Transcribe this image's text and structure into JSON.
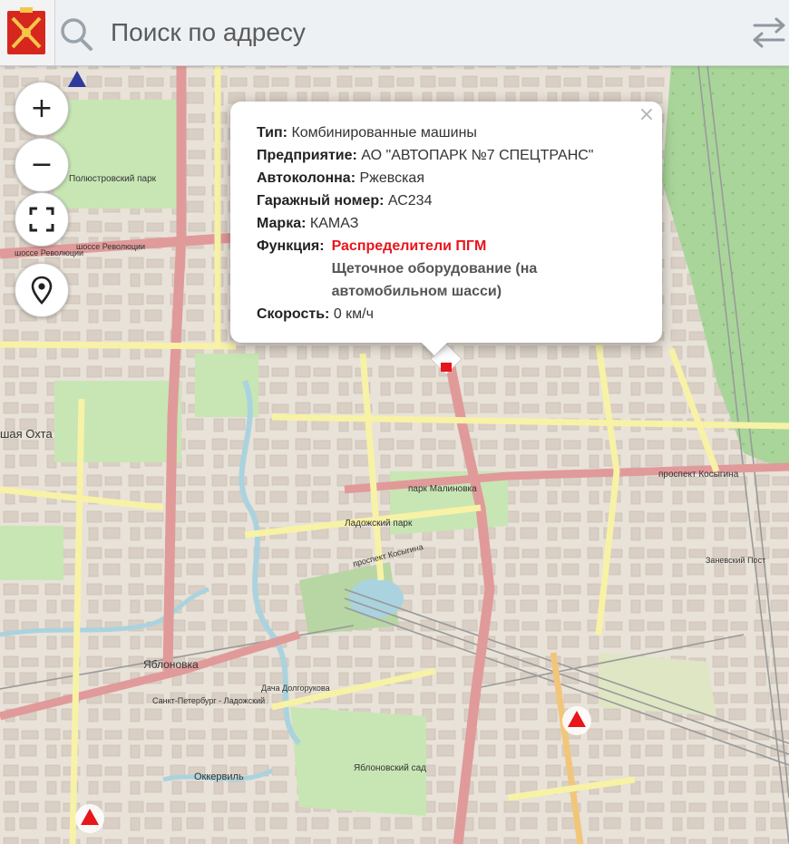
{
  "search": {
    "placeholder": "Поиск по адресу"
  },
  "icons": {
    "logo": "spb-coat-of-arms",
    "search": "search-icon",
    "swap": "swap-arrows-icon",
    "zoom_in": "plus-icon",
    "zoom_out": "minus-icon",
    "fullscreen": "fullscreen-icon",
    "locate": "location-pin-icon",
    "close": "close-icon"
  },
  "controls": {
    "zoom_in": "+",
    "zoom_out": "−"
  },
  "popup": {
    "close": "×",
    "rows": [
      {
        "label": "Тип:",
        "value": "Комбинированные машины"
      },
      {
        "label": "Предприятие:",
        "value": "АО \"АВТОПАРК №7 СПЕЦТРАНС\""
      },
      {
        "label": "Автоколонна:",
        "value": "Ржевская"
      },
      {
        "label": "Гаражный номер:",
        "value": "АС234"
      },
      {
        "label": "Марка:",
        "value": "КАМАЗ"
      }
    ],
    "function_label": "Функция:",
    "functions": [
      "Распределители ПГМ",
      "Щеточное оборудование (на автомобильном шасси)"
    ],
    "speed_label": "Скорость:",
    "speed_value": "0 км/ч"
  },
  "map_labels": {
    "polyustrovsky": "Полюстровский парк",
    "shosse_revolyutsii_1": "шоссе Революции",
    "shosse_revolyutsii_2": "шоссе Революции",
    "okhta": "шая Охта",
    "park_malinovka": "парк Малиновка",
    "ladozhsky_park": "Ладожский парк",
    "prospekt_kosygina": "проспект Косыгина",
    "zanevsky_post": "Заневский Пост",
    "yablonovka": "Яблоновка",
    "dacha": "Дача Долгорукова",
    "spb_ladozhsky": "Санкт-Петербург - Ладожский",
    "yablonovsky_sad": "Яблоновский сад",
    "okkervil": "Оккервиль",
    "prospekt_kosygina_2": "проспект Косыгина"
  },
  "colors": {
    "accent_red": "#e8151b",
    "marker_blue": "#2e3a9e",
    "major_road": "#e09a9a",
    "secondary_road": "#f7f2a6",
    "park": "#c8e6b4",
    "forest": "#a9d59a",
    "water": "#aad3df"
  }
}
